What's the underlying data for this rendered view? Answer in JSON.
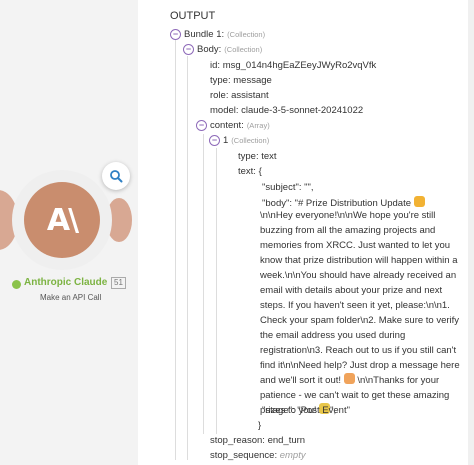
{
  "module": {
    "title": "Anthropic Claude",
    "id_badge": "51",
    "subtitle": "Make an API Call",
    "logo_text": "A\\",
    "logo_color": "#c98d6e",
    "status_color": "#8bc34a"
  },
  "output": {
    "header": "OUTPUT",
    "bundle_label": "Bundle 1:",
    "bundle_type": "(Collection)",
    "body_label": "Body:",
    "body_type": "(Collection)",
    "id_key": "id:",
    "id_value": "msg_014n4hgEaZEeyJWyRo2vqVfk",
    "type_key": "type:",
    "type_value": "message",
    "role_key": "role:",
    "role_value": "assistant",
    "model_key": "model:",
    "model_value": "claude-3-5-sonnet-20241022",
    "content_label": "content:",
    "content_type": "(Array)",
    "item_label": "1",
    "item_type": "(Collection)",
    "item_type_key": "type:",
    "item_type_value": "text",
    "text_key": "text:",
    "text_open": "{",
    "json_subject": "\"subject\": \"\",",
    "json_body_1": "\"body\": \"# Prize Distribution Update",
    "json_body_2": "\\n\\nHey everyone!\\n\\nWe hope you're still buzzing from all the amazing projects and memories from XRCC. Just wanted to let you know that prize distribution will happen within a week.\\n\\nYou should have already received an email with details about your prize and next steps. If you haven't seen it yet, please:\\n\\n1. Check your spam folder\\n2. Make sure to verify the email address you used during registration\\n3. Reach out to us if you still can't find it\\n\\nNeed help? Just drop a message here and we'll sort it out!",
    "json_body_3": "\\n\\nThanks for your patience - we can't wait to get these amazing prizes to you!",
    "json_body_4": "\",",
    "json_stage": "\"stage\": \"Post Event\"",
    "text_close": "}",
    "stop_reason_key": "stop_reason:",
    "stop_reason_value": "end_turn",
    "stop_sequence_key": "stop_sequence:",
    "stop_sequence_value": "empty",
    "accent_color": "#8e6ab9"
  }
}
